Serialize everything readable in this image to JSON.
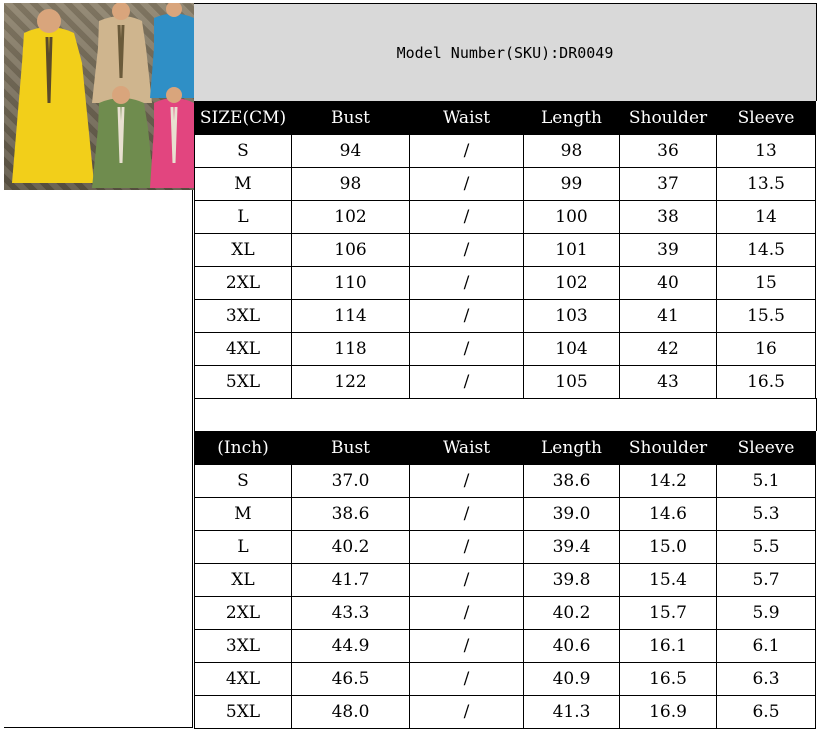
{
  "model_label": "Model Number(SKU):DR0049",
  "cm_table": {
    "headers": [
      "SIZE(CM)",
      "Bust",
      "Waist",
      "Length",
      "Shoulder",
      "Sleeve"
    ],
    "rows": [
      [
        "S",
        "94",
        "/",
        "98",
        "36",
        "13"
      ],
      [
        "M",
        "98",
        "/",
        "99",
        "37",
        "13.5"
      ],
      [
        "L",
        "102",
        "/",
        "100",
        "38",
        "14"
      ],
      [
        "XL",
        "106",
        "/",
        "101",
        "39",
        "14.5"
      ],
      [
        "2XL",
        "110",
        "/",
        "102",
        "40",
        "15"
      ],
      [
        "3XL",
        "114",
        "/",
        "103",
        "41",
        "15.5"
      ],
      [
        "4XL",
        "118",
        "/",
        "104",
        "42",
        "16"
      ],
      [
        "5XL",
        "122",
        "/",
        "105",
        "43",
        "16.5"
      ]
    ]
  },
  "inch_table": {
    "headers": [
      "(Inch)",
      "Bust",
      "Waist",
      "Length",
      "Shoulder",
      "Sleeve"
    ],
    "rows": [
      [
        "S",
        "37.0",
        "/",
        "38.6",
        "14.2",
        "5.1"
      ],
      [
        "M",
        "38.6",
        "/",
        "39.0",
        "14.6",
        "5.3"
      ],
      [
        "L",
        "40.2",
        "/",
        "39.4",
        "15.0",
        "5.5"
      ],
      [
        "XL",
        "41.7",
        "/",
        "39.8",
        "15.4",
        "5.7"
      ],
      [
        "2XL",
        "43.3",
        "/",
        "40.2",
        "15.7",
        "5.9"
      ],
      [
        "3XL",
        "44.9",
        "/",
        "40.6",
        "16.1",
        "6.1"
      ],
      [
        "4XL",
        "46.5",
        "/",
        "40.9",
        "16.5",
        "6.3"
      ],
      [
        "5XL",
        "48.0",
        "/",
        "41.3",
        "16.9",
        "6.5"
      ]
    ]
  },
  "photo": {
    "dress_colors": [
      "#f2cf1a",
      "#cfb58e",
      "#2f8fc6",
      "#6f8c4e",
      "#e2457f"
    ]
  }
}
